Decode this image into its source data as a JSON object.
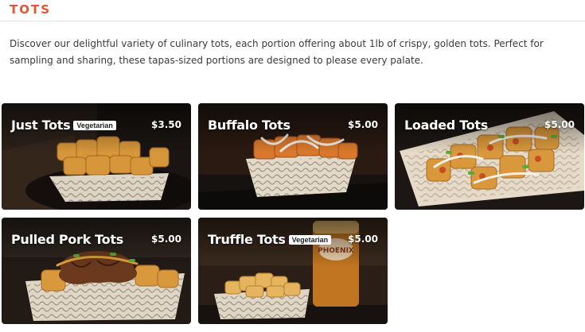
{
  "section": {
    "title": "TOTS",
    "intro": "Discover our delightful variety of culinary tots, each portion offering about 1lb of crispy, golden tots. Perfect for sampling and sharing, these tapas-sized portions are designed to please every palate."
  },
  "items": [
    {
      "name": "Just Tots",
      "badge": "Vegetarian",
      "price": "$3.50"
    },
    {
      "name": "Buffalo Tots",
      "badge": "",
      "price": "$5.00"
    },
    {
      "name": "Loaded Tots",
      "badge": "",
      "price": "$5.00"
    },
    {
      "name": "Pulled Pork Tots",
      "badge": "",
      "price": "$5.00"
    },
    {
      "name": "Truffle Tots",
      "badge": "Vegetarian",
      "price": "$5.00"
    }
  ],
  "colors": {
    "accent": "#e4572e",
    "tot": "#d99a3a",
    "boat_pattern": "#8a7560"
  }
}
